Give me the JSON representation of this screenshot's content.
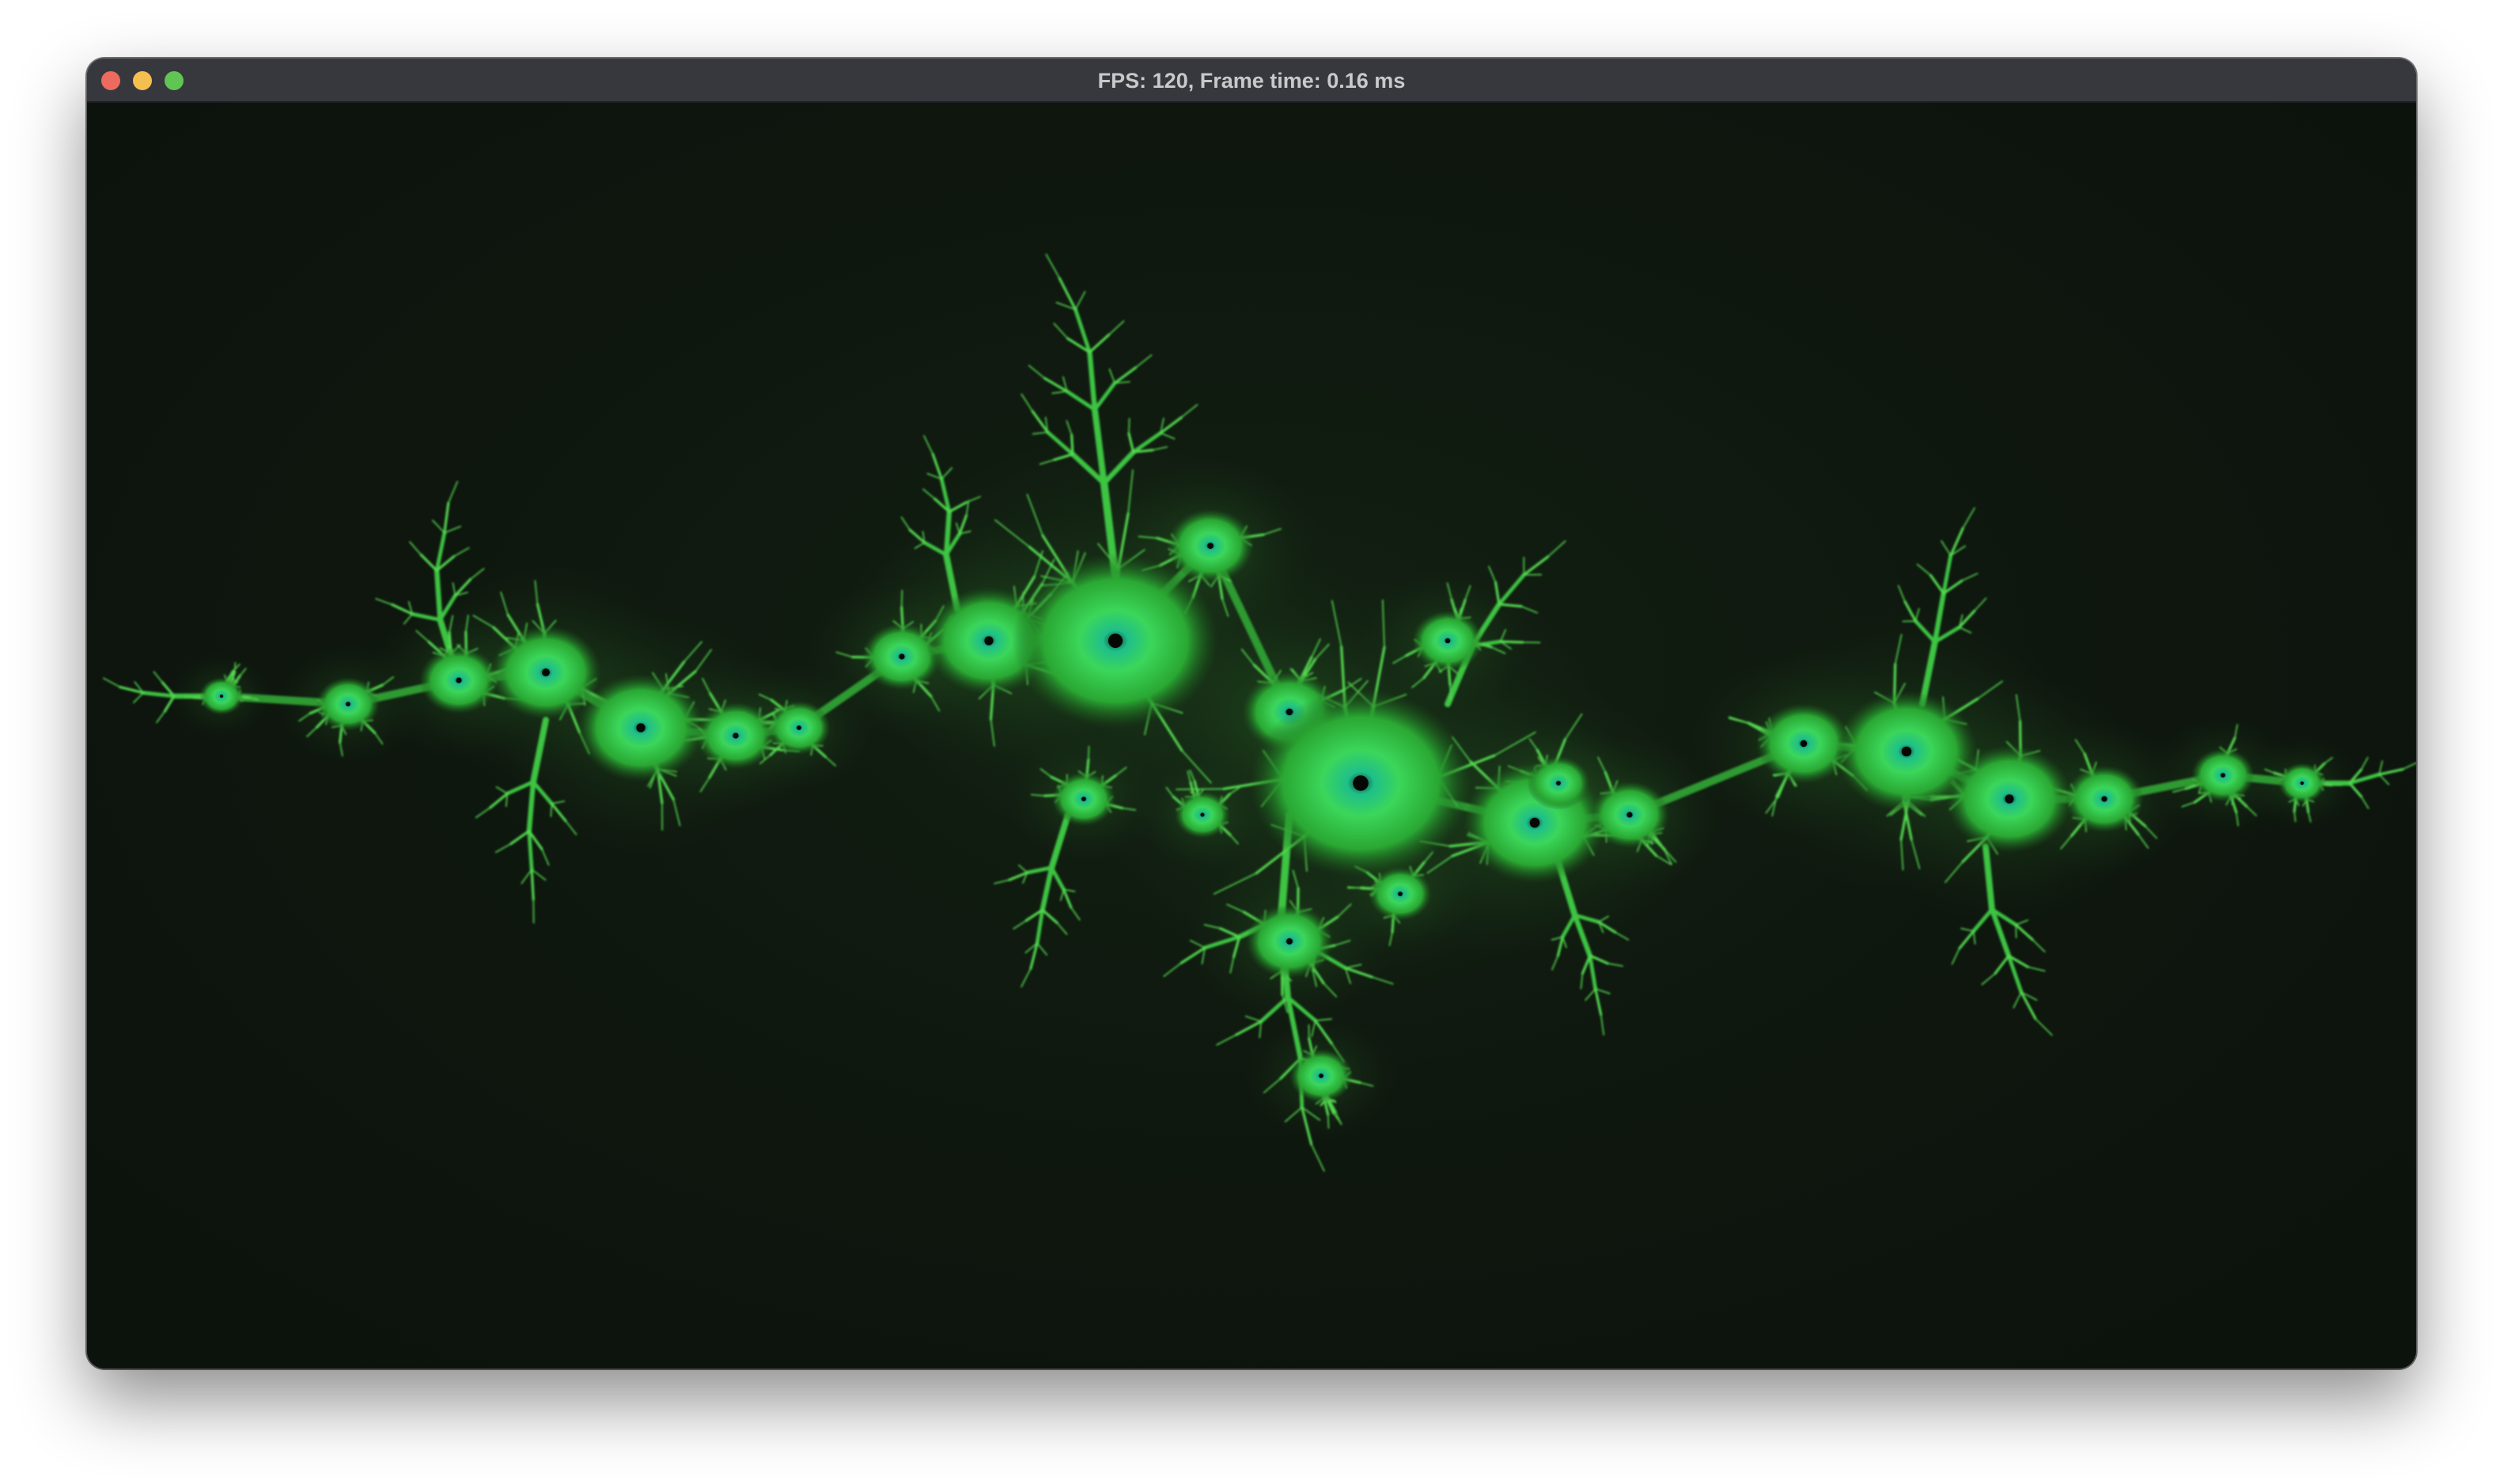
{
  "window": {
    "title": "FPS: 120, Frame time: 0.16 ms",
    "controls": {
      "close_color": "#ed6a5e",
      "minimize_color": "#f5bf4f",
      "zoom_color": "#61c554"
    }
  },
  "render": {
    "content": "julia-set-fractal",
    "background_color": "#0f150f",
    "fractal_colors": {
      "outer": "#1f6f1f",
      "mid": "#3fd24a",
      "core": "#2fd7a0",
      "center": "#050805"
    }
  }
}
